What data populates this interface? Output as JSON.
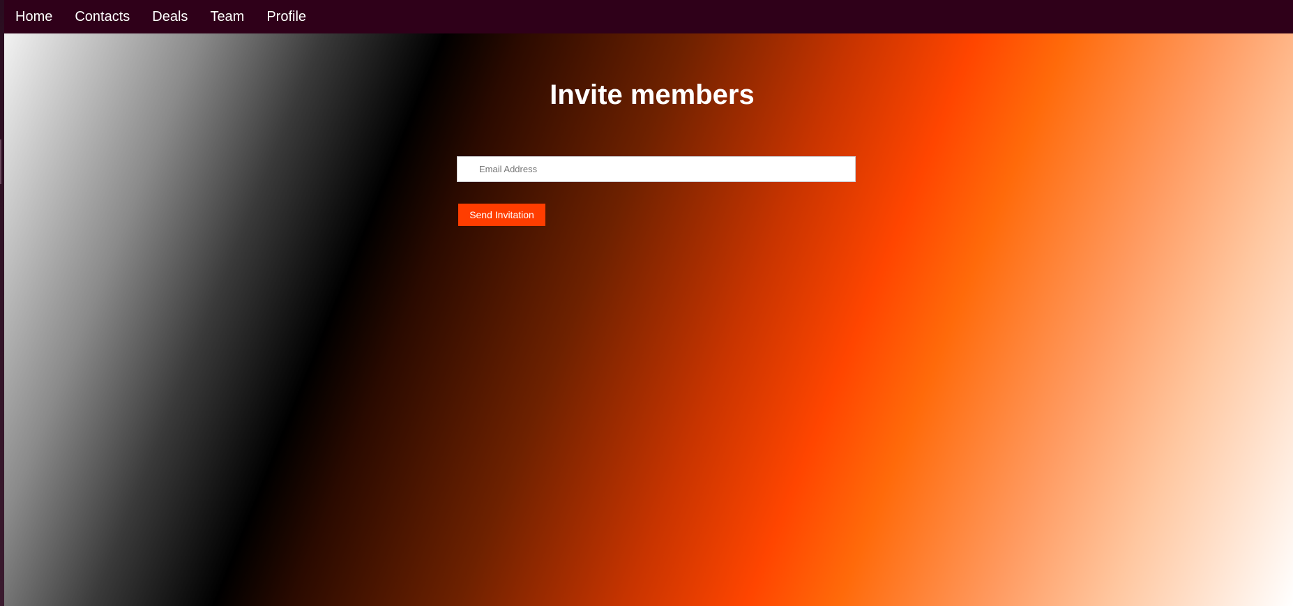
{
  "nav": {
    "items": [
      {
        "label": "Home"
      },
      {
        "label": "Contacts"
      },
      {
        "label": "Deals"
      },
      {
        "label": "Team"
      },
      {
        "label": "Profile"
      }
    ]
  },
  "main": {
    "title": "Invite members",
    "email_placeholder": "Email Address",
    "email_value": "",
    "send_label": "Send Invitation"
  },
  "colors": {
    "navbar_bg": "#2f0019",
    "accent": "#ff3d00",
    "text_light": "#ffffff"
  }
}
